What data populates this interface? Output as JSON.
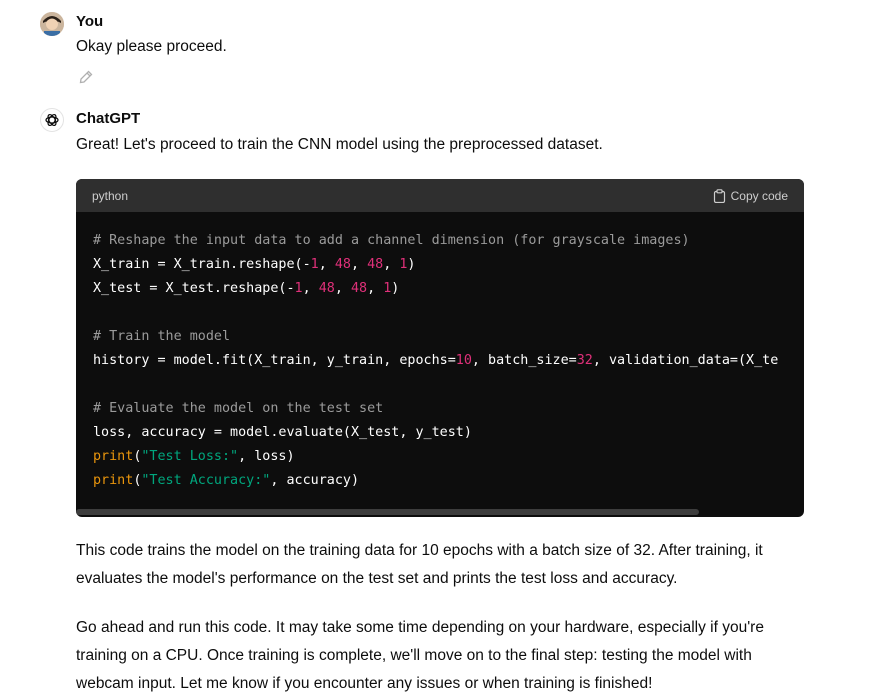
{
  "user_message": {
    "author": "You",
    "text": "Okay please proceed."
  },
  "assistant_message": {
    "author": "ChatGPT",
    "intro": "Great! Let's proceed to train the CNN model using the preprocessed dataset.",
    "code": {
      "language": "python",
      "copy_label": "Copy code",
      "lines": [
        [
          {
            "t": "# Reshape the input data to add a channel dimension (for grayscale images)",
            "c": "c-comment"
          }
        ],
        [
          {
            "t": "X_train = X_train.reshape(-"
          },
          {
            "t": "1",
            "c": "c-num"
          },
          {
            "t": ", "
          },
          {
            "t": "48",
            "c": "c-num"
          },
          {
            "t": ", "
          },
          {
            "t": "48",
            "c": "c-num"
          },
          {
            "t": ", "
          },
          {
            "t": "1",
            "c": "c-num"
          },
          {
            "t": ")"
          }
        ],
        [
          {
            "t": "X_test = X_test.reshape(-"
          },
          {
            "t": "1",
            "c": "c-num"
          },
          {
            "t": ", "
          },
          {
            "t": "48",
            "c": "c-num"
          },
          {
            "t": ", "
          },
          {
            "t": "48",
            "c": "c-num"
          },
          {
            "t": ", "
          },
          {
            "t": "1",
            "c": "c-num"
          },
          {
            "t": ")"
          }
        ],
        [],
        [
          {
            "t": "# Train the model",
            "c": "c-comment"
          }
        ],
        [
          {
            "t": "history = model.fit(X_train, y_train, epochs="
          },
          {
            "t": "10",
            "c": "c-num"
          },
          {
            "t": ", batch_size="
          },
          {
            "t": "32",
            "c": "c-num"
          },
          {
            "t": ", validation_data=(X_te"
          }
        ],
        [],
        [
          {
            "t": "# Evaluate the model on the test set",
            "c": "c-comment"
          }
        ],
        [
          {
            "t": "loss, accuracy = model.evaluate(X_test, y_test)"
          }
        ],
        [
          {
            "t": "print",
            "c": "c-builtin"
          },
          {
            "t": "("
          },
          {
            "t": "\"Test Loss:\"",
            "c": "c-str"
          },
          {
            "t": ", loss)"
          }
        ],
        [
          {
            "t": "print",
            "c": "c-builtin"
          },
          {
            "t": "("
          },
          {
            "t": "\"Test Accuracy:\"",
            "c": "c-str"
          },
          {
            "t": ", accuracy)"
          }
        ]
      ]
    },
    "paragraph1_line1": "This code trains the model on the training data for 10 epochs with a batch size of 32. After training, it",
    "paragraph1_line2": "evaluates the model's performance on the test set and prints the test loss and accuracy.",
    "paragraph2_line1": "Go ahead and run this code. It may take some time depending on your hardware, especially if you're",
    "paragraph2_line2": "training on a CPU. Once training is complete, we'll move on to the final step: testing the model with",
    "paragraph2_line3": "webcam input. Let me know if you encounter any issues or when training is finished!"
  }
}
